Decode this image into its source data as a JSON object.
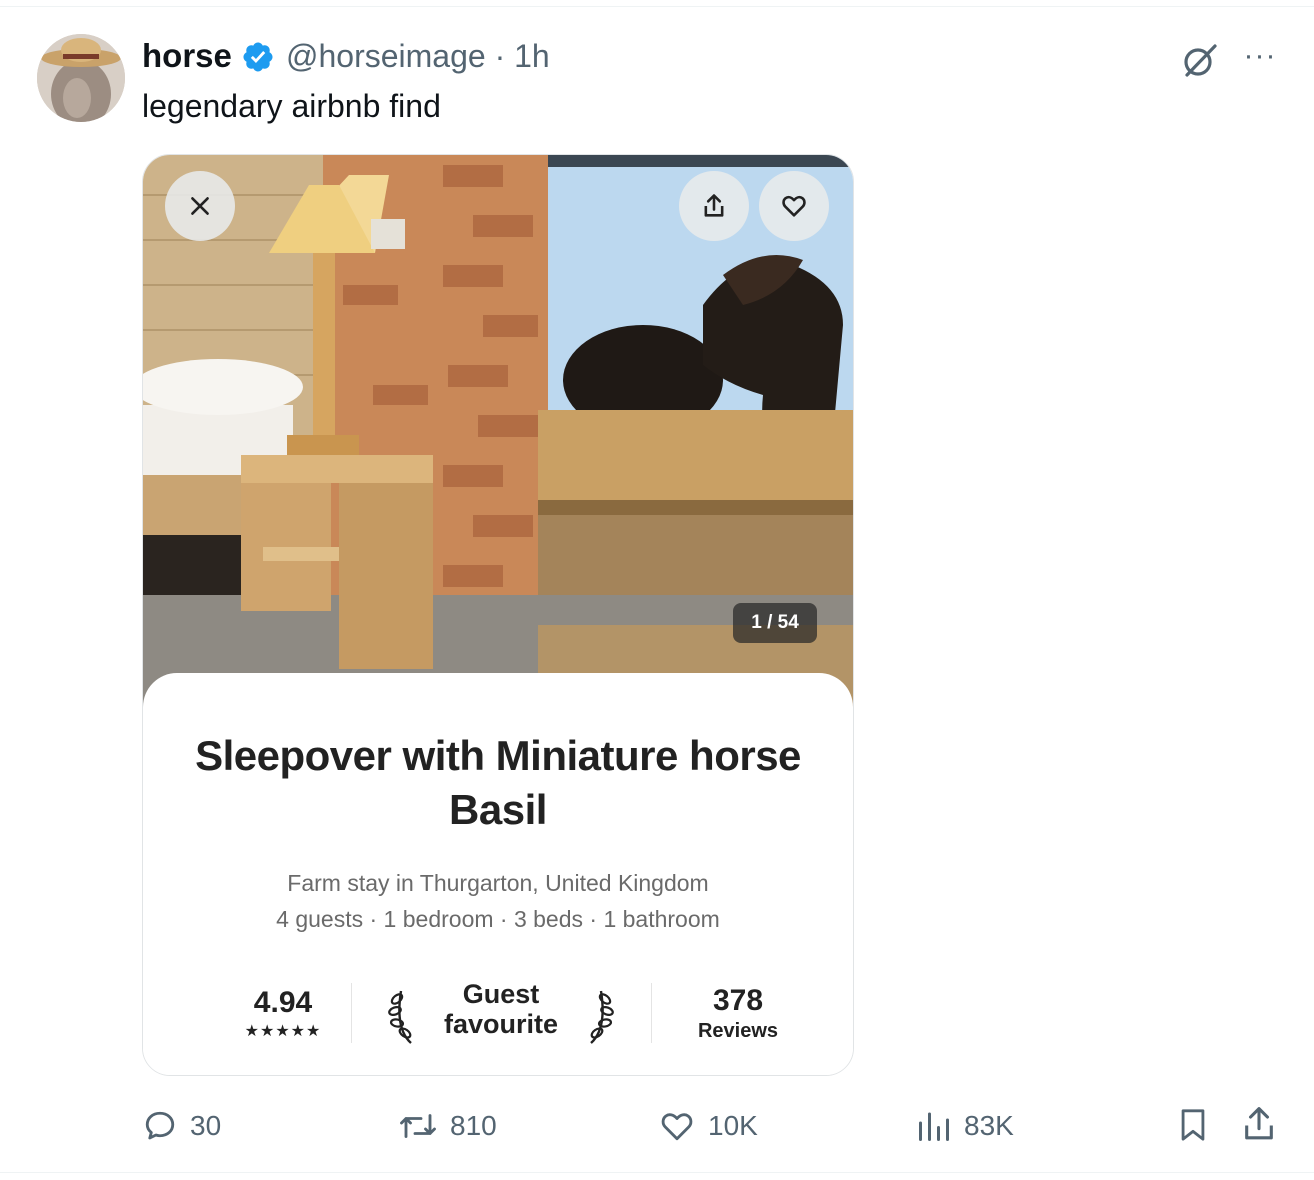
{
  "tweet": {
    "display_name": "horse",
    "handle_time": "@horseimage · 1h",
    "text": "legendary airbnb find",
    "more_label": "···"
  },
  "listing": {
    "photo_counter": "1 / 54",
    "title": "Sleepover with Miniature horse Basil",
    "location": "Farm stay in Thurgarton, United Kingdom",
    "details": "4 guests · 1 bedroom · 3 beds · 1 bathroom",
    "rating": "4.94",
    "stars": "★★★★★",
    "badge": "Guest favourite",
    "reviews_count": "378",
    "reviews_label": "Reviews"
  },
  "actions": {
    "replies": "30",
    "reposts": "810",
    "likes": "10K",
    "views": "83K"
  },
  "colors": {
    "verified": "#1d9bf0",
    "secondary_text": "#536471",
    "listing_text": "#222222"
  }
}
